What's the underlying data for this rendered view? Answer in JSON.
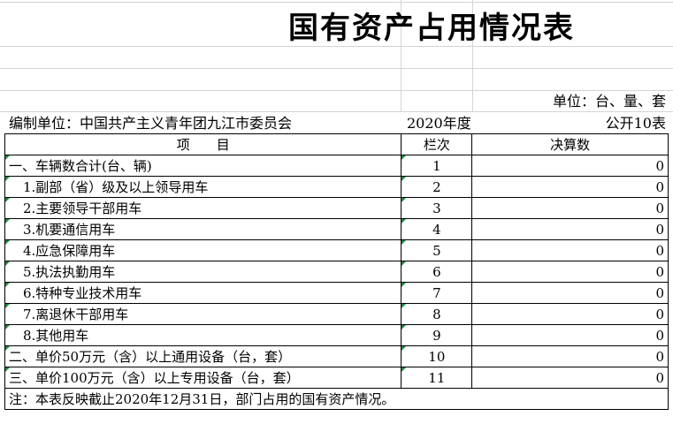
{
  "title": "国有资产占用情况表",
  "unit_label": "单位：台、量、套",
  "compiler_label": "编制单位：中国共产主义青年团九江市委员会",
  "year": "2020年度",
  "form_code": "公开10表",
  "headers": {
    "item": "项　　目",
    "col": "栏次",
    "value": "决算数"
  },
  "rows": [
    {
      "item": "一、车辆数合计(台、辆)",
      "col": "1",
      "value": "0",
      "sub": false
    },
    {
      "item": "1.副部（省）级及以上领导用车",
      "col": "2",
      "value": "0",
      "sub": true
    },
    {
      "item": "2.主要领导干部用车",
      "col": "3",
      "value": "0",
      "sub": true
    },
    {
      "item": "3.机要通信用车",
      "col": "4",
      "value": "0",
      "sub": true
    },
    {
      "item": "4.应急保障用车",
      "col": "5",
      "value": "0",
      "sub": true
    },
    {
      "item": "5.执法执勤用车",
      "col": "6",
      "value": "0",
      "sub": true
    },
    {
      "item": "6.特种专业技术用车",
      "col": "7",
      "value": "0",
      "sub": true
    },
    {
      "item": "7.离退休干部用车",
      "col": "8",
      "value": "0",
      "sub": true
    },
    {
      "item": "8.其他用车",
      "col": "9",
      "value": "0",
      "sub": true
    },
    {
      "item": "二、单价50万元（含）以上通用设备（台，套）",
      "col": "10",
      "value": "0",
      "sub": false
    },
    {
      "item": "三、单价100万元（含）以上专用设备（台，套）",
      "col": "11",
      "value": "0",
      "sub": false
    }
  ],
  "note": "注：本表反映截止2020年12月31日，部门占用的国有资产情况。",
  "colors": {
    "cell_marker": "#1d8a3a",
    "gridline": "#d4d4d4"
  }
}
